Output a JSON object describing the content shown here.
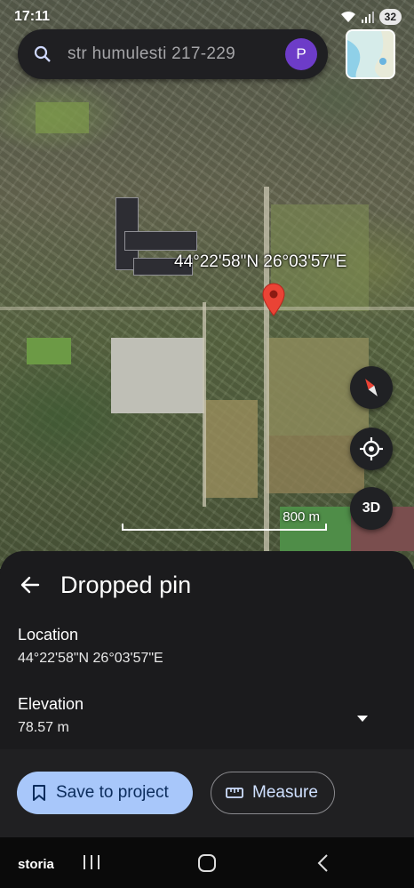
{
  "status_bar": {
    "time": "17:11",
    "battery": "32"
  },
  "search": {
    "query": "str humulesti 217-229",
    "avatar_letter": "P"
  },
  "map": {
    "coordinate_label": "44°22'58\"N 26°03'57\"E",
    "scale_label": "800 m",
    "view_3d_label": "3D"
  },
  "sheet": {
    "title": "Dropped pin",
    "location_label": "Location",
    "location_value": "44°22'58\"N 26°03'57\"E",
    "elevation_label": "Elevation",
    "elevation_value": "78.57 m"
  },
  "actions": {
    "save_label": "Save to project",
    "measure_label": "Measure"
  },
  "nav": {
    "app_label": "storia"
  },
  "colors": {
    "accent": "#a8c7fa",
    "pin": "#ea4335",
    "avatar": "#6d3cc8"
  }
}
